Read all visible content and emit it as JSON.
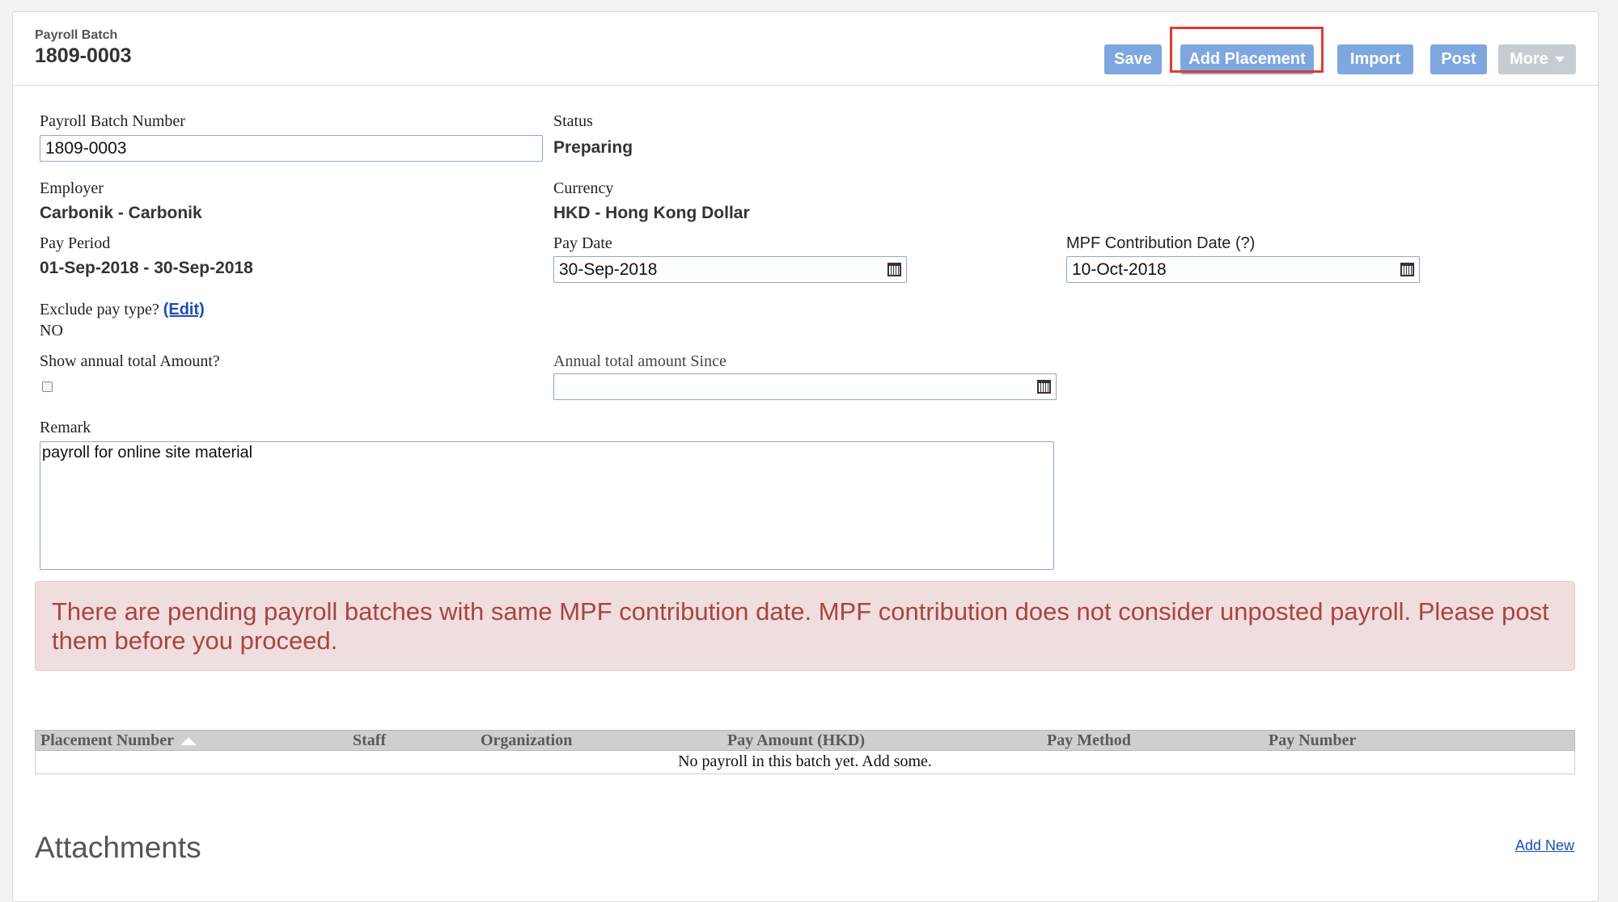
{
  "header": {
    "kicker": "Payroll Batch",
    "title": "1809-0003",
    "buttons": {
      "save": "Save",
      "add_placement": "Add Placement",
      "import": "Import",
      "post": "Post",
      "more": "More"
    }
  },
  "form": {
    "batch_number": {
      "label": "Payroll Batch Number",
      "value": "1809-0003"
    },
    "status": {
      "label": "Status",
      "value": "Preparing"
    },
    "employer": {
      "label": "Employer",
      "value": "Carbonik - Carbonik"
    },
    "currency": {
      "label": "Currency",
      "value": "HKD - Hong Kong Dollar"
    },
    "pay_period": {
      "label": "Pay Period",
      "value": "01-Sep-2018 - 30-Sep-2018"
    },
    "pay_date": {
      "label": "Pay Date",
      "value": "30-Sep-2018"
    },
    "mpf_date": {
      "label": "MPF Contribution Date (?)",
      "value": "10-Oct-2018"
    },
    "exclude_pay_type": {
      "label": "Exclude pay type?",
      "edit_link": "(Edit)",
      "value": "NO"
    },
    "show_annual": {
      "label": "Show annual total Amount?",
      "checked": false
    },
    "annual_since": {
      "label": "Annual total amount Since",
      "value": ""
    },
    "remark": {
      "label": "Remark",
      "value": "payroll for online site material"
    }
  },
  "alert": {
    "text": "There are pending payroll batches with same MPF contribution date. MPF contribution does not consider unposted payroll. Please post them before you proceed.",
    "color": "#a94442"
  },
  "table": {
    "columns": [
      "Placement Number",
      "Staff",
      "Organization",
      "Pay Amount (HKD)",
      "Pay Method",
      "Pay Number"
    ],
    "empty_message": "No payroll in this batch yet. Add some."
  },
  "attachments": {
    "title": "Attachments",
    "add_new": "Add New"
  },
  "colors": {
    "button": "#7ea7e0",
    "button_disabled": "#c7ccd3",
    "highlight": "#e03c2f",
    "link": "#1a4fb5"
  }
}
